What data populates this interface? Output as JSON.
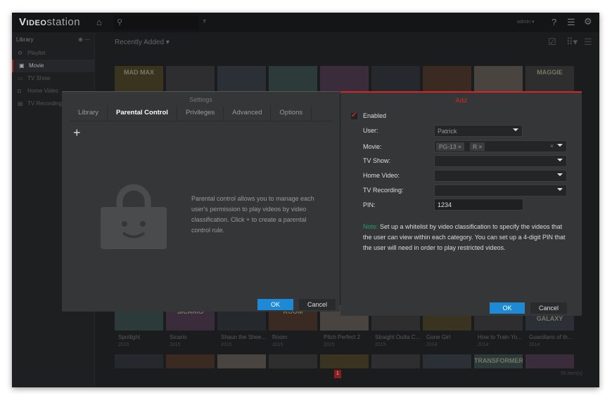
{
  "app": {
    "logo_v": "V",
    "logo_ideo": "IDEO",
    "logo_station": "station",
    "user": "admin",
    "search_placeholder": ""
  },
  "sidebar": {
    "header": "Library",
    "items": [
      {
        "label": "Playlist",
        "icon": "playlist-icon"
      },
      {
        "label": "Movie",
        "icon": "movie-icon",
        "active": true
      },
      {
        "label": "TV Show",
        "icon": "tv-icon"
      },
      {
        "label": "Home Video",
        "icon": "camera-icon"
      },
      {
        "label": "TV Recording",
        "icon": "recording-icon"
      }
    ]
  },
  "main": {
    "section": "Recently Added",
    "top_posters": [
      "MAD MAX",
      "",
      "",
      "",
      "",
      "",
      "",
      "",
      "MAGGIE"
    ],
    "row2": [
      {
        "title": "Spotlight",
        "year": "2015",
        "text": ""
      },
      {
        "title": "Sicario",
        "year": "2015",
        "text": "SICARIO"
      },
      {
        "title": "Shaun the Shee...",
        "year": "2015",
        "text": ""
      },
      {
        "title": "Room",
        "year": "2015",
        "text": "ROOM"
      },
      {
        "title": "Pitch Perfect 2",
        "year": "2015",
        "text": ""
      },
      {
        "title": "Straight Outta C...",
        "year": "2015",
        "text": ""
      },
      {
        "title": "Gone Girl",
        "year": "2014",
        "text": ""
      },
      {
        "title": "How to Train Yo...",
        "year": "2014",
        "text": ""
      },
      {
        "title": "Guardians of th...",
        "year": "2014",
        "text": "GUARDIANS GALAXY"
      }
    ],
    "row3": [
      "",
      "",
      "",
      "",
      "",
      "",
      "",
      "TRANSFORMERS",
      ""
    ],
    "page": "1",
    "items_count": "55 item(s)"
  },
  "settings": {
    "title": "Settings",
    "tabs": [
      "Library",
      "Parental Control",
      "Privileges",
      "Advanced",
      "Options"
    ],
    "active_tab": "Parental Control",
    "description": "Parental control allows you to manage each user's permission to play videos by video classification. Click + to create a parental control rule.",
    "ok": "OK",
    "cancel": "Cancel"
  },
  "add": {
    "title": "Add",
    "enabled_label": "Enabled",
    "enabled": true,
    "user_label": "User:",
    "user_value": "Patrick",
    "movie_label": "Movie:",
    "movie_values": [
      "PG-13",
      "R"
    ],
    "tvshow_label": "TV Show:",
    "homevideo_label": "Home Video:",
    "tvrec_label": "TV Recording:",
    "pin_label": "PIN:",
    "pin_value": "1234",
    "note_label": "Note:",
    "note_text": "Set up a whitelist by video classification to specify the videos that the user can view within each category. You can set up a 4-digit PIN that the user will need in order to play restricted videos.",
    "ok": "OK",
    "cancel": "Cancel"
  },
  "colors": {
    "accent": "#d42828",
    "ok": "#1e8ad6",
    "note": "#1fa06a"
  }
}
